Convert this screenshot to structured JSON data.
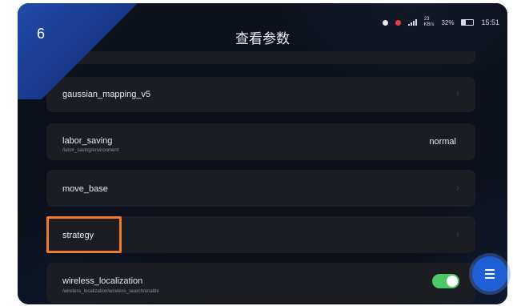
{
  "corner_number": "6",
  "title": "查看参数",
  "status": {
    "net_speed_value": "23",
    "net_speed_unit": "KB/s",
    "battery": "32%",
    "time": "15:51",
    "battery_level": 0.32
  },
  "params": [
    {
      "name": "gaussian_mapping_v5",
      "path": "",
      "value": ""
    },
    {
      "name": "labor_saving",
      "path": "/labor_saving/environment",
      "value": "normal"
    },
    {
      "name": "move_base",
      "path": "",
      "value": ""
    },
    {
      "name": "strategy",
      "path": "",
      "value": ""
    },
    {
      "name": "wireless_localization",
      "path": "/wireless_localization/wireless_search/enable",
      "value": ""
    }
  ],
  "wireless_toggle_on": true,
  "colors": {
    "highlight": "#f07c2a",
    "toggle_on": "#4cc764",
    "accent": "#1e5fd6"
  }
}
